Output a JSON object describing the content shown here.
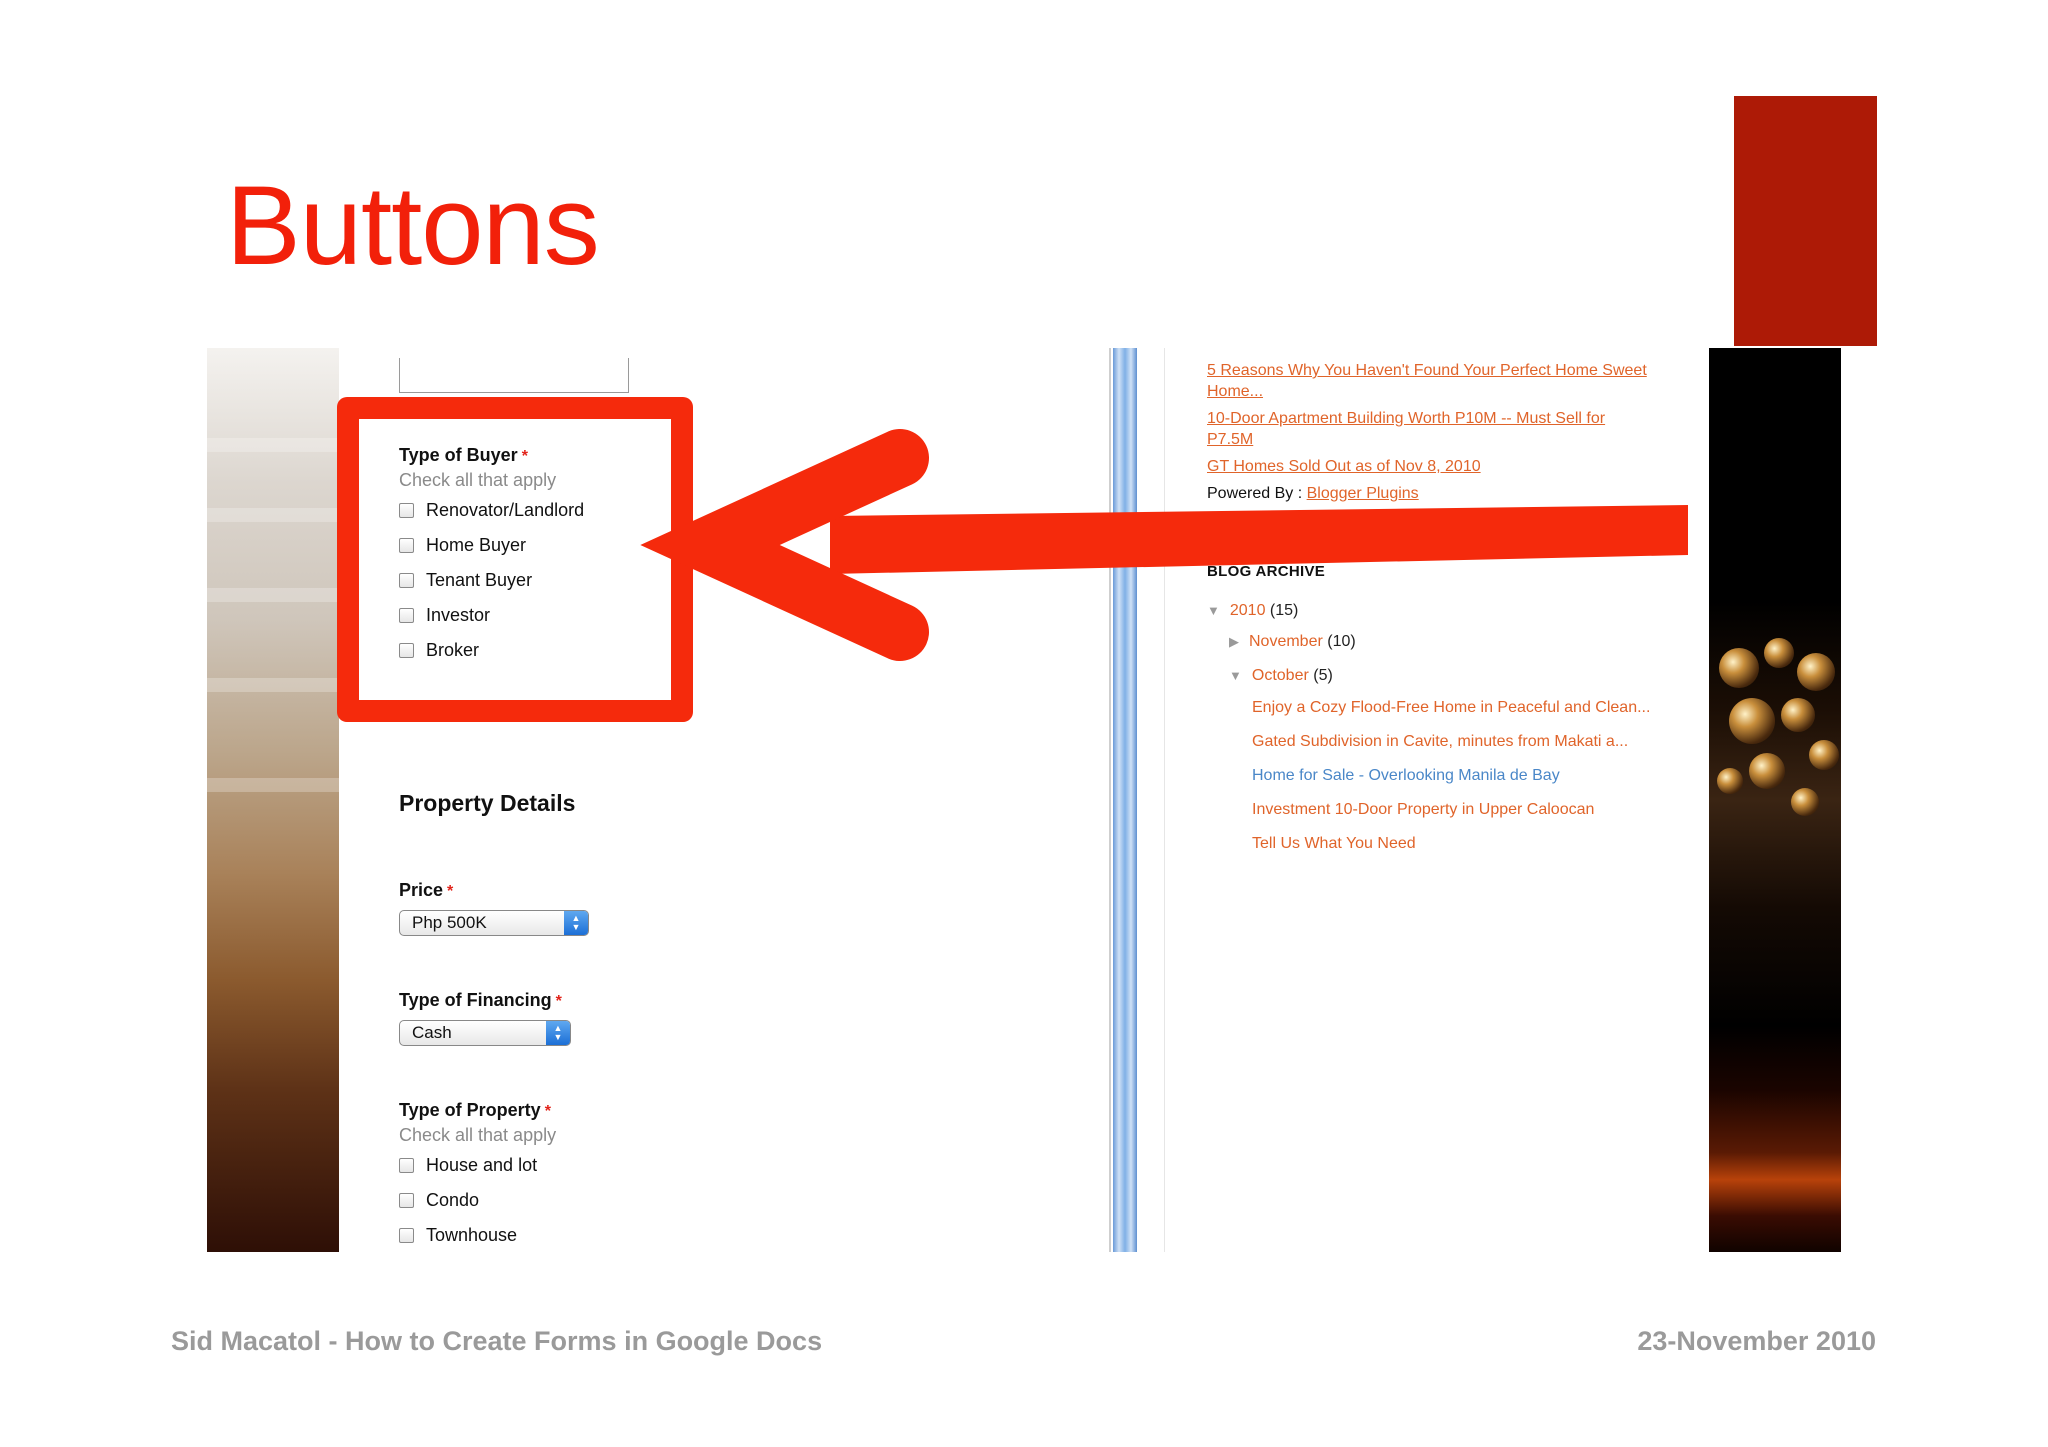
{
  "slide": {
    "title": "Buttons",
    "footer_left": "Sid Macatol - How to Create Forms in Google Docs",
    "footer_right": "23-November 2010",
    "accent_color": "#f2200a",
    "square_color": "#ad1a06"
  },
  "form": {
    "buyer": {
      "label": "Type of Buyer",
      "required_mark": "*",
      "help": "Check all that apply",
      "options": [
        "Renovator/Landlord",
        "Home Buyer",
        "Tenant Buyer",
        "Investor",
        "Broker"
      ]
    },
    "section_title": "Property Details",
    "price": {
      "label": "Price",
      "required_mark": "*",
      "value": "Php 500K"
    },
    "financing": {
      "label": "Type of Financing",
      "required_mark": "*",
      "value": "Cash"
    },
    "property": {
      "label": "Type of Property",
      "required_mark": "*",
      "help": "Check all that apply",
      "options": [
        "House and lot",
        "Condo",
        "Townhouse"
      ]
    }
  },
  "blog": {
    "recent_posts": [
      "5 Reasons Why You Haven't Found Your Perfect Home Sweet Home...",
      "10-Door Apartment Building Worth P10M -- Must Sell for P7.5M",
      "GT Homes Sold Out as of Nov 8, 2010"
    ],
    "powered_by_label": "Powered By :",
    "powered_by_link": "Blogger Plugins",
    "archive_title": "BLOG ARCHIVE",
    "archive": {
      "year": "2010",
      "year_count": "(15)",
      "months": [
        {
          "name": "November",
          "count": "(10)",
          "expanded": false
        },
        {
          "name": "October",
          "count": "(5)",
          "expanded": true
        }
      ],
      "october_posts": [
        {
          "title": "Enjoy a Cozy Flood-Free Home in Peaceful and Clean...",
          "color": "#e0642a"
        },
        {
          "title": "Gated Subdivision in Cavite, minutes from Makati a...",
          "color": "#e0642a"
        },
        {
          "title": "Home for Sale - Overlooking Manila de Bay",
          "color": "#4a87c8"
        },
        {
          "title": "Investment 10-Door Property in Upper Caloocan",
          "color": "#e0642a"
        },
        {
          "title": "Tell Us What You Need",
          "color": "#e0642a"
        }
      ]
    }
  },
  "icons": {
    "expanded": "triangle-down-icon",
    "collapsed": "triangle-right-icon",
    "select": "select-arrows-icon"
  }
}
